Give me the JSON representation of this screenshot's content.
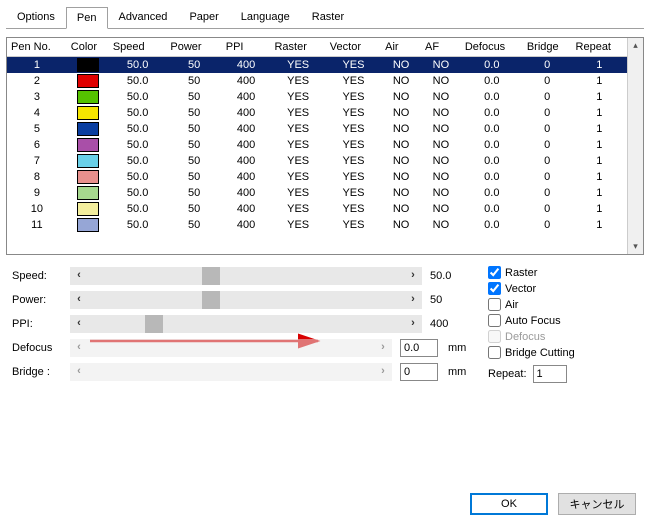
{
  "tabs": [
    "Options",
    "Pen",
    "Advanced",
    "Paper",
    "Language",
    "Raster"
  ],
  "active_tab_index": 1,
  "columns": [
    "Pen No.",
    "Color",
    "Speed",
    "Power",
    "PPI",
    "Raster",
    "Vector",
    "Air",
    "AF",
    "Defocus",
    "Bridge",
    "Repeat"
  ],
  "pens": [
    {
      "no": "1",
      "color": "#000000",
      "speed": "50.0",
      "power": "50",
      "ppi": "400",
      "raster": "YES",
      "vector": "YES",
      "air": "NO",
      "af": "NO",
      "defocus": "0.0",
      "bridge": "0",
      "repeat": "1",
      "sel": true
    },
    {
      "no": "2",
      "color": "#e00000",
      "speed": "50.0",
      "power": "50",
      "ppi": "400",
      "raster": "YES",
      "vector": "YES",
      "air": "NO",
      "af": "NO",
      "defocus": "0.0",
      "bridge": "0",
      "repeat": "1"
    },
    {
      "no": "3",
      "color": "#55c200",
      "speed": "50.0",
      "power": "50",
      "ppi": "400",
      "raster": "YES",
      "vector": "YES",
      "air": "NO",
      "af": "NO",
      "defocus": "0.0",
      "bridge": "0",
      "repeat": "1"
    },
    {
      "no": "4",
      "color": "#f6e600",
      "speed": "50.0",
      "power": "50",
      "ppi": "400",
      "raster": "YES",
      "vector": "YES",
      "air": "NO",
      "af": "NO",
      "defocus": "0.0",
      "bridge": "0",
      "repeat": "1"
    },
    {
      "no": "5",
      "color": "#0a3ea0",
      "speed": "50.0",
      "power": "50",
      "ppi": "400",
      "raster": "YES",
      "vector": "YES",
      "air": "NO",
      "af": "NO",
      "defocus": "0.0",
      "bridge": "0",
      "repeat": "1"
    },
    {
      "no": "6",
      "color": "#a94fa8",
      "speed": "50.0",
      "power": "50",
      "ppi": "400",
      "raster": "YES",
      "vector": "YES",
      "air": "NO",
      "af": "NO",
      "defocus": "0.0",
      "bridge": "0",
      "repeat": "1"
    },
    {
      "no": "7",
      "color": "#69d0e8",
      "speed": "50.0",
      "power": "50",
      "ppi": "400",
      "raster": "YES",
      "vector": "YES",
      "air": "NO",
      "af": "NO",
      "defocus": "0.0",
      "bridge": "0",
      "repeat": "1"
    },
    {
      "no": "8",
      "color": "#e8908d",
      "speed": "50.0",
      "power": "50",
      "ppi": "400",
      "raster": "YES",
      "vector": "YES",
      "air": "NO",
      "af": "NO",
      "defocus": "0.0",
      "bridge": "0",
      "repeat": "1"
    },
    {
      "no": "9",
      "color": "#a6d88e",
      "speed": "50.0",
      "power": "50",
      "ppi": "400",
      "raster": "YES",
      "vector": "YES",
      "air": "NO",
      "af": "NO",
      "defocus": "0.0",
      "bridge": "0",
      "repeat": "1"
    },
    {
      "no": "10",
      "color": "#f3ee9d",
      "speed": "50.0",
      "power": "50",
      "ppi": "400",
      "raster": "YES",
      "vector": "YES",
      "air": "NO",
      "af": "NO",
      "defocus": "0.0",
      "bridge": "0",
      "repeat": "1"
    },
    {
      "no": "11",
      "color": "#96a6d6",
      "speed": "50.0",
      "power": "50",
      "ppi": "400",
      "raster": "YES",
      "vector": "YES",
      "air": "NO",
      "af": "NO",
      "defocus": "0.0",
      "bridge": "0",
      "repeat": "1"
    }
  ],
  "sliders": {
    "speed": {
      "label": "Speed:",
      "value": "50.0",
      "enabled": true,
      "thumb_pct": 36
    },
    "power": {
      "label": "Power:",
      "value": "50",
      "enabled": true,
      "thumb_pct": 36
    },
    "ppi": {
      "label": "PPI:",
      "value": "400",
      "enabled": true,
      "thumb_pct": 18
    },
    "defocus": {
      "label": "Defocus",
      "value": "0.0",
      "unit": "mm",
      "enabled": false
    },
    "bridge": {
      "label": "Bridge :",
      "value": "0",
      "unit": "mm",
      "enabled": false
    }
  },
  "checks": {
    "raster": {
      "label": "Raster",
      "checked": true,
      "enabled": true
    },
    "vector": {
      "label": "Vector",
      "checked": true,
      "enabled": true
    },
    "air": {
      "label": "Air",
      "checked": false,
      "enabled": true
    },
    "autofocus": {
      "label": "Auto Focus",
      "checked": false,
      "enabled": true
    },
    "defocus": {
      "label": "Defocus",
      "checked": false,
      "enabled": false
    },
    "bridgecut": {
      "label": "Bridge Cutting",
      "checked": false,
      "enabled": true
    }
  },
  "repeat": {
    "label": "Repeat:",
    "value": "1"
  },
  "buttons": {
    "ok": "OK",
    "cancel": "キャンセル"
  }
}
